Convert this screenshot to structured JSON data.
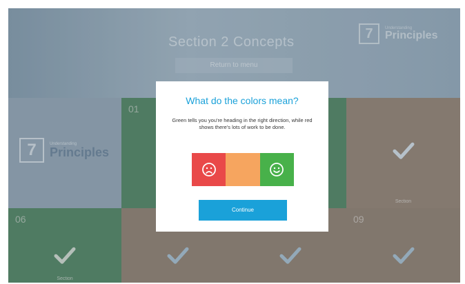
{
  "header": {
    "title": "Section 2 Concepts",
    "button_label": "Return to menu",
    "brand_number": "7",
    "brand_small": "Understanding",
    "brand_big": "Principles"
  },
  "tiles": {
    "principles": {
      "brand_number": "7",
      "small": "Understanding",
      "big": "Principles"
    },
    "row1_green_number": "01",
    "row3_first_number": "06",
    "row3_last_number": "09",
    "caption": "Section"
  },
  "modal": {
    "title": "What do the colors mean?",
    "body": "Green tells you you're heading in the right direction, while red shows there's lots of work to be done.",
    "faces": [
      "sad-face-icon",
      "neutral",
      "happy-face-icon"
    ],
    "continue_label": "Continue"
  },
  "colors": {
    "accent": "#1aa1d9",
    "red": "#e94949",
    "orange": "#f6a55f",
    "green": "#48b14a"
  }
}
